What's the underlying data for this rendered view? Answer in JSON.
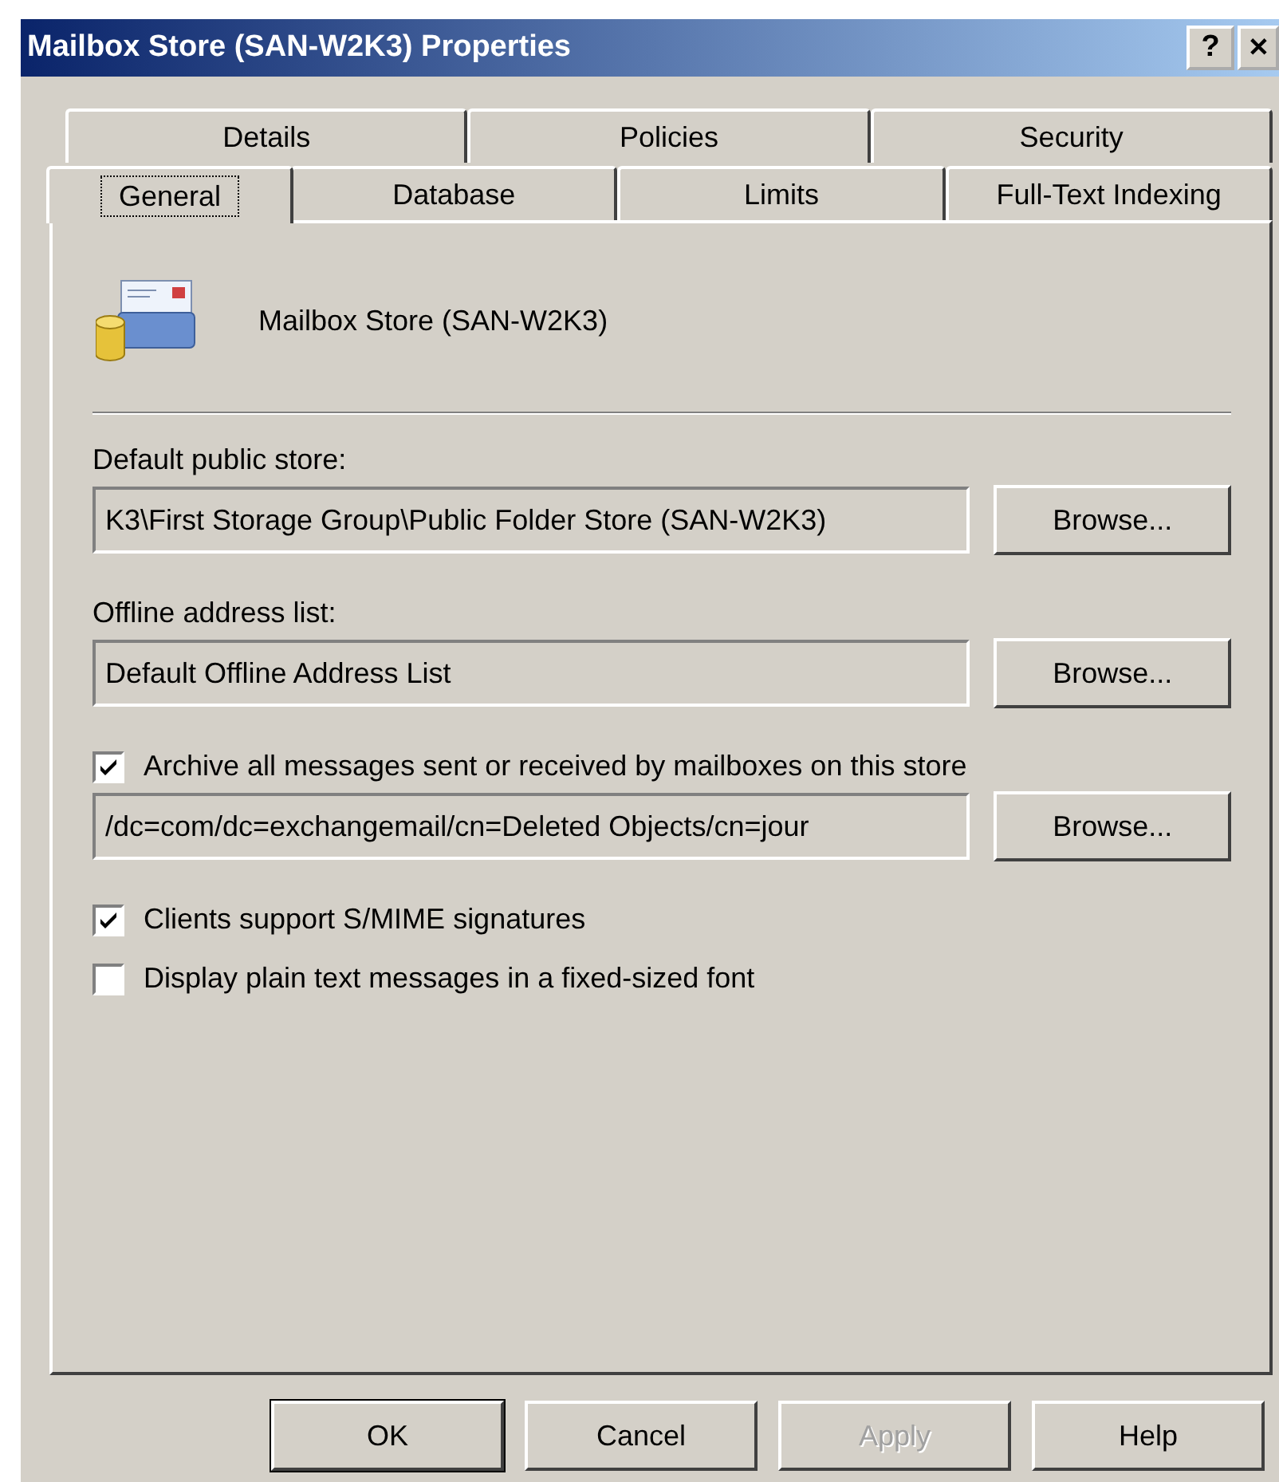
{
  "window": {
    "title": "Mailbox Store (SAN-W2K3) Properties",
    "title_buttons": [
      {
        "kind": "help",
        "label": "?"
      },
      {
        "kind": "close",
        "label": "✕"
      }
    ]
  },
  "tab_rows": [
    [
      {
        "label": "Details",
        "selected": false
      },
      {
        "label": "Policies",
        "selected": false
      },
      {
        "label": "Security",
        "selected": false
      }
    ],
    [
      {
        "label": "General",
        "selected": true
      },
      {
        "label": "Database",
        "selected": false
      },
      {
        "label": "Limits",
        "selected": false
      },
      {
        "label": "Full-Text Indexing",
        "selected": false
      }
    ]
  ],
  "header": {
    "name": "Mailbox Store (SAN-W2K3)"
  },
  "fields": [
    {
      "kind": "labeled",
      "label": "Default public store:",
      "value": "K3\\First Storage Group\\Public Folder Store (SAN-W2K3)",
      "button": "Browse..."
    },
    {
      "kind": "labeled",
      "label": "Offline address list:",
      "value": "Default Offline Address List",
      "button": "Browse..."
    },
    {
      "kind": "checked",
      "label": "Archive all messages sent or received by mailboxes on this store",
      "checked": true,
      "value": "/dc=com/dc=exchangemail/cn=Deleted Objects/cn=jour",
      "button": "Browse..."
    }
  ],
  "options": [
    {
      "label": "Clients support S/MIME signatures",
      "checked": true
    },
    {
      "label": "Display plain text messages in a fixed-sized font",
      "checked": false
    }
  ],
  "buttons": [
    {
      "label": "OK",
      "disabled": false,
      "default": true
    },
    {
      "label": "Cancel",
      "disabled": false,
      "default": false
    },
    {
      "label": "Apply",
      "disabled": true,
      "default": false
    },
    {
      "label": "Help",
      "disabled": false,
      "default": false
    }
  ]
}
